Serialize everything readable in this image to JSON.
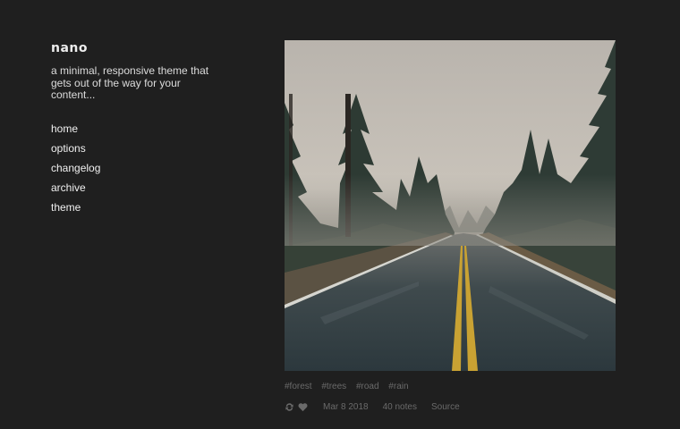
{
  "blog": {
    "title": "nano",
    "description": "a minimal, responsive theme that gets out of the way for your content..."
  },
  "nav": {
    "items": [
      {
        "label": "home"
      },
      {
        "label": "options"
      },
      {
        "label": "changelog"
      },
      {
        "label": "archive"
      },
      {
        "label": "theme"
      }
    ]
  },
  "post": {
    "tags": [
      "#forest",
      "#trees",
      "#road",
      "#rain"
    ],
    "date": "Mar 8 2018",
    "notes": "40 notes",
    "source": "Source",
    "icons": [
      "reblog-icon",
      "heart-icon"
    ]
  },
  "colors": {
    "background": "#1f1f1f",
    "text": "#e6e6e6",
    "muted": "#6a6a6a"
  }
}
